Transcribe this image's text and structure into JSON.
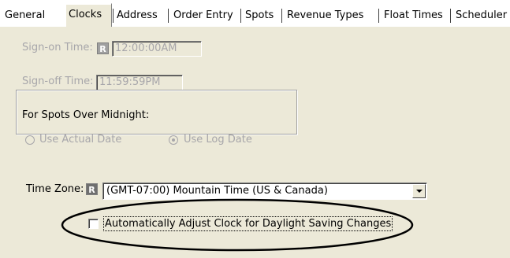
{
  "tabs": [
    {
      "label": "General",
      "active": false
    },
    {
      "label": "Clocks",
      "active": true
    },
    {
      "label": "Address",
      "active": false
    },
    {
      "label": "Order Entry",
      "active": false
    },
    {
      "label": "Spots",
      "active": false
    },
    {
      "label": "Revenue Types",
      "active": false
    },
    {
      "label": "Float Times",
      "active": false
    },
    {
      "label": "Scheduler",
      "active": false
    }
  ],
  "clocks": {
    "sign_on_label": "Sign-on Time:",
    "sign_on_badge": "R",
    "sign_on_value": "12:00:00AM",
    "sign_off_label": "Sign-off Time:",
    "sign_off_value": "11:59:59PM",
    "midnight_group_title": "For Spots Over Midnight:",
    "radio_actual_label": "Use Actual Date",
    "radio_log_label": "Use Log Date",
    "selected_radio": "Use Log Date",
    "time_zone_label": "Time Zone:",
    "time_zone_badge": "R",
    "time_zone_value": "(GMT-07:00) Mountain Time (US & Canada)",
    "auto_adjust_label": "Automatically Adjust Clock for Daylight Saving Changes",
    "auto_adjust_checked": false
  },
  "colors": {
    "panel_bg": "#ece9d8",
    "disabled_text": "#a7a6aa",
    "annotation_ellipse": "#000000"
  },
  "icons": {
    "combo_arrow": "chevron-down-icon",
    "badge": "r-badge-icon"
  }
}
